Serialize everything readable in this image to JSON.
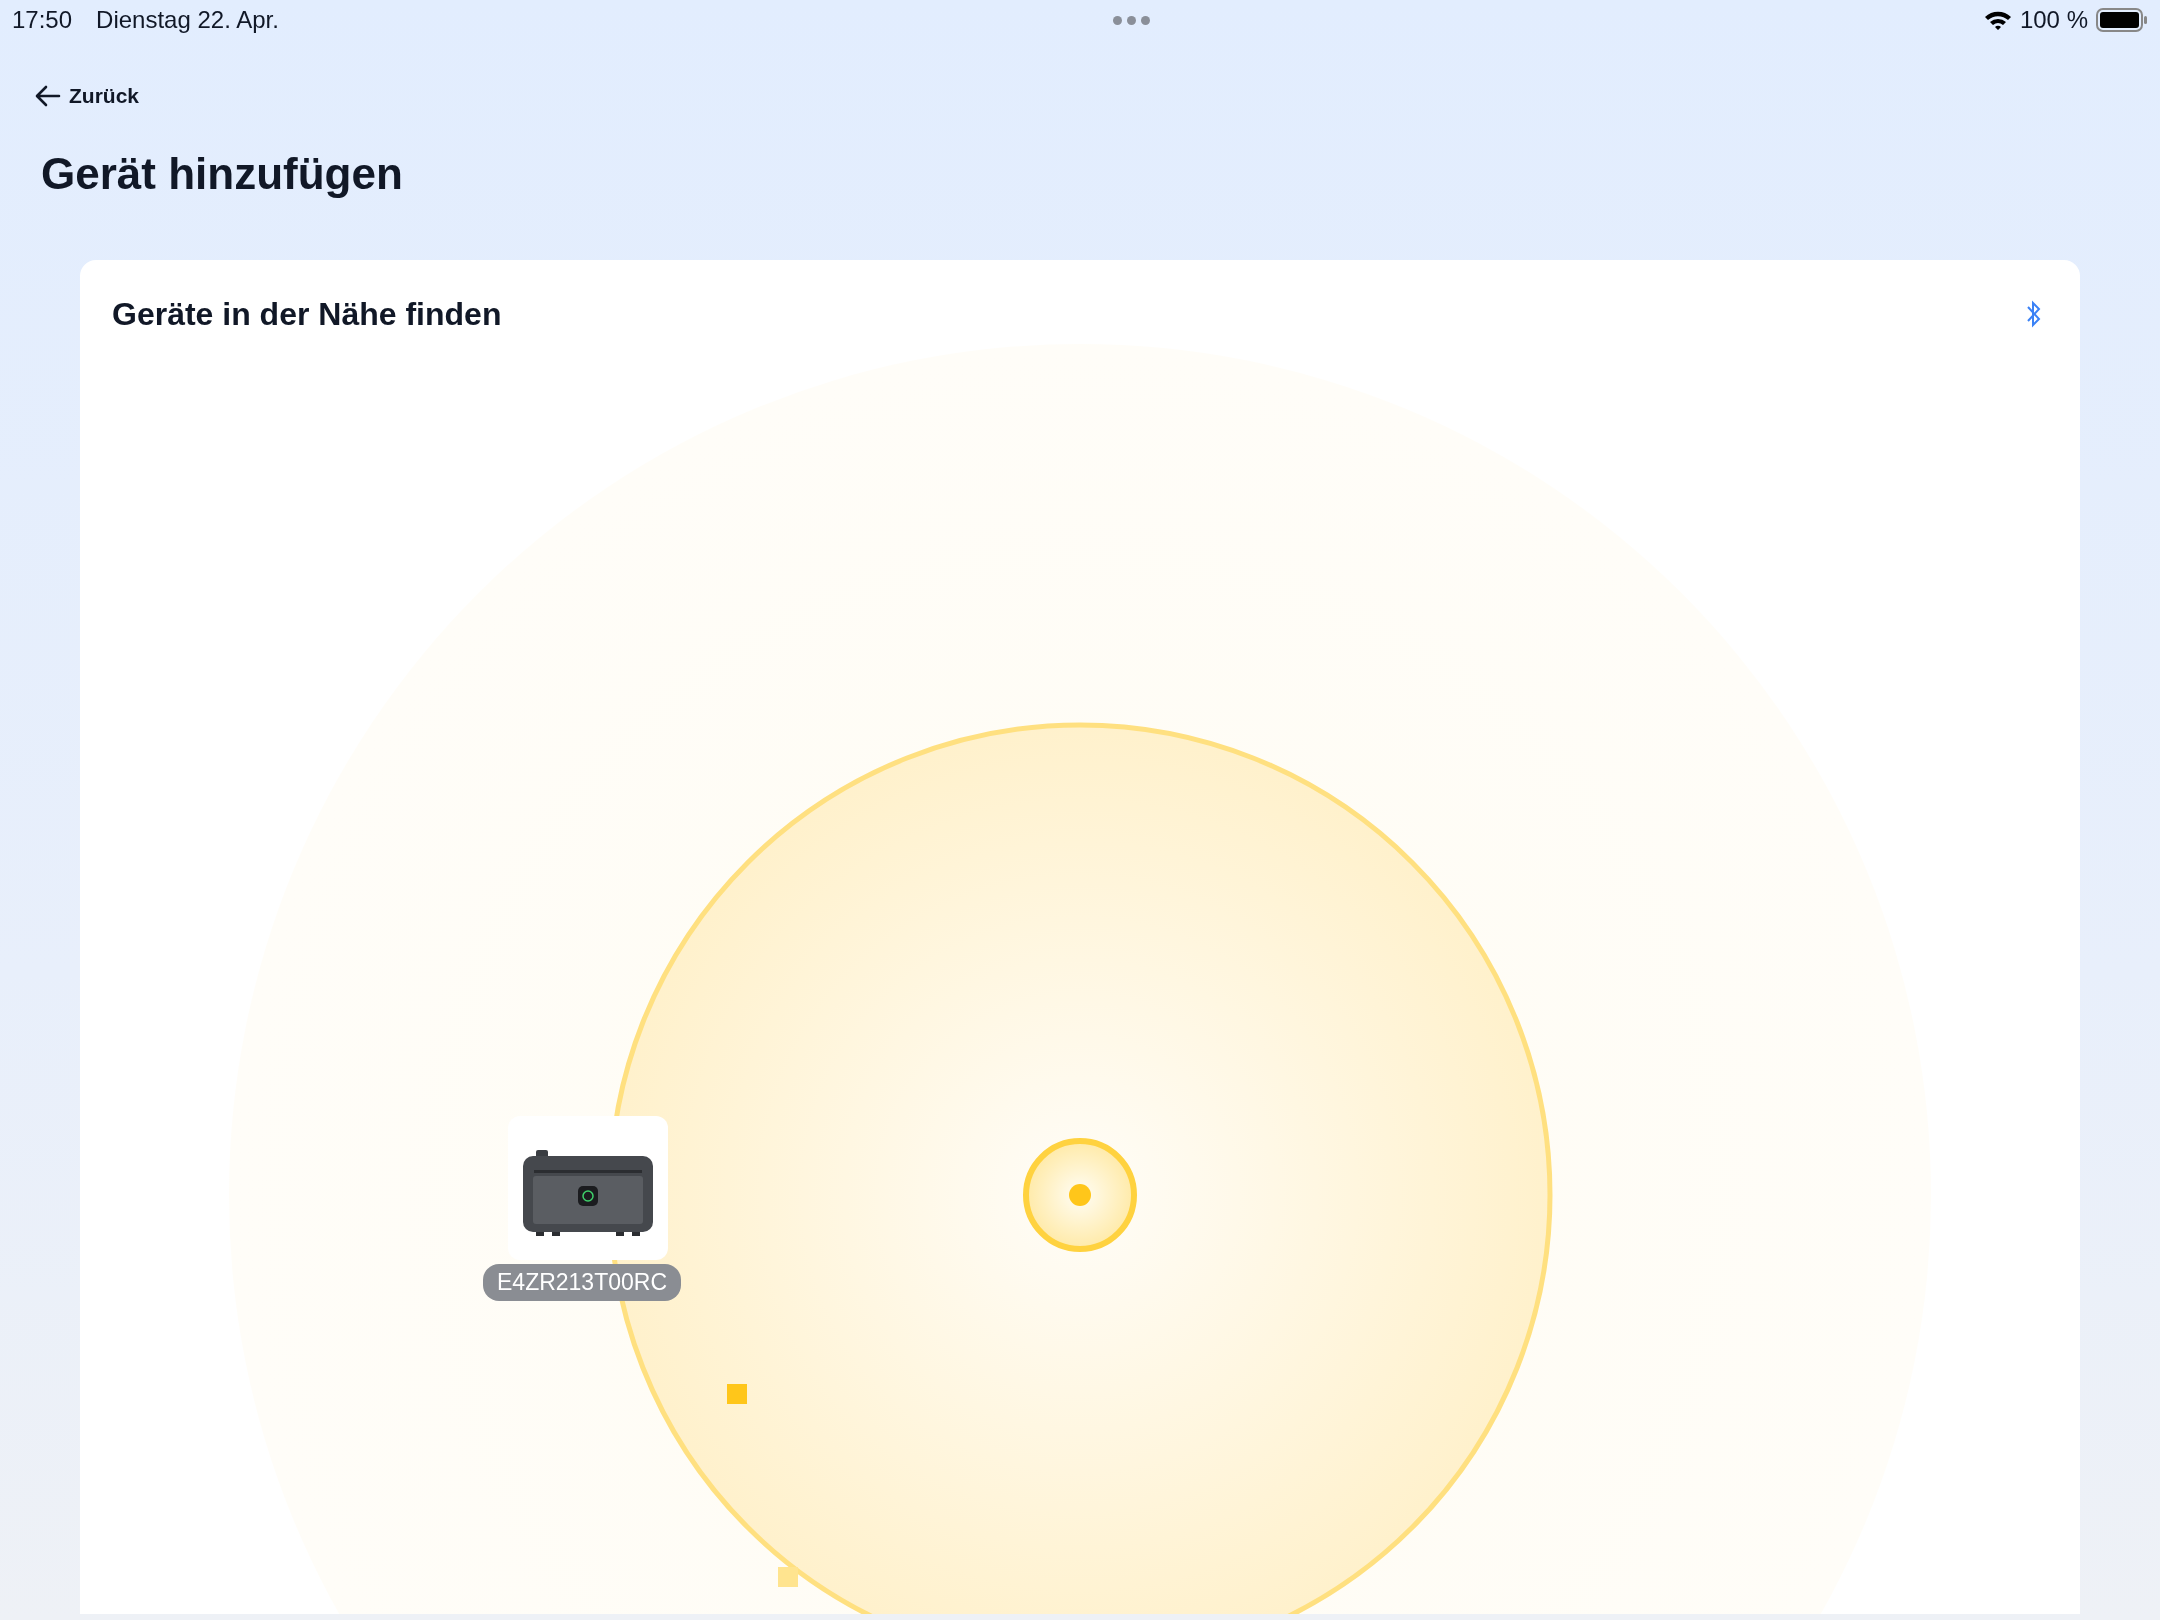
{
  "status_bar": {
    "time": "17:50",
    "date": "Dienstag 22. Apr.",
    "battery": "100 %"
  },
  "back_link": "Zurück",
  "title": "Gerät hinzufügen",
  "panel": {
    "title": "Geräte in der Nähe finden",
    "devices": [
      {
        "serial": "E4ZR213T00RC"
      }
    ]
  }
}
